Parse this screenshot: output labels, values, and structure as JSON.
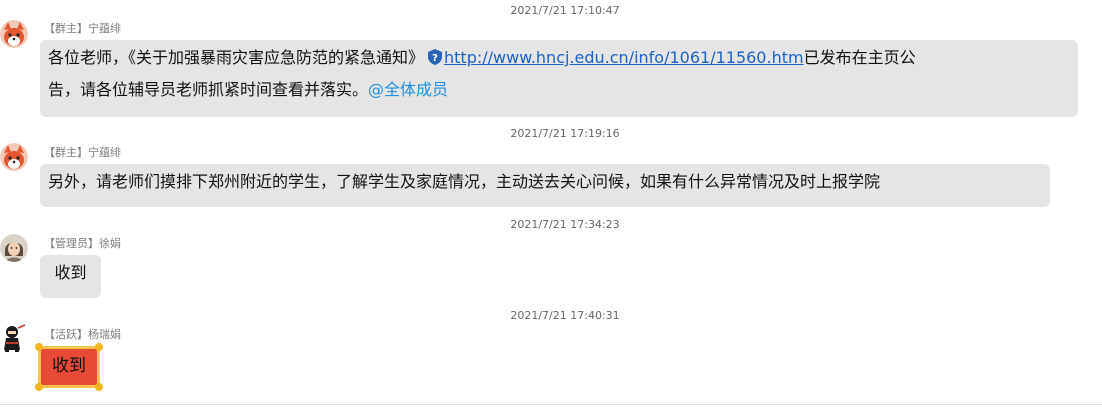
{
  "messages": [
    {
      "timestamp": "2021/7/21 17:10:47",
      "role": "【群主】",
      "sender": "宁蕴绯",
      "text_before": "各位老师，《关于加强暴雨灾害应急防范的紧急通知》",
      "link": "http://www.hncj.edu.cn/info/1061/11560.htm",
      "text_after": "已发布在主页公",
      "line2": "告，请各位辅导员老师抓紧时间查看并落实。",
      "mention": "@全体成员"
    },
    {
      "timestamp": "2021/7/21 17:19:16",
      "role": "【群主】",
      "sender": "宁蕴绯",
      "text": "另外，请老师们摸排下郑州附近的学生，了解学生及家庭情况，主动送去关心问候，如果有什么异常情况及时上报学院"
    },
    {
      "timestamp": "2021/7/21 17:34:23",
      "role": "【管理员】",
      "sender": "徐娟",
      "text": "收到"
    },
    {
      "timestamp": "2021/7/21 17:40:31",
      "role": "【活跃】",
      "sender": "杨瑞娟",
      "text": "收到"
    }
  ],
  "colors": {
    "bubble": "#e5e5e5",
    "link": "#1a62c9",
    "mention": "#1f8fe0",
    "red_bubble": "#e94a35",
    "red_bubble_border": "#f6c54a"
  },
  "icons": [
    "fox-avatar-icon",
    "security-shield-icon",
    "woman-avatar-icon",
    "ninja-avatar-icon"
  ]
}
